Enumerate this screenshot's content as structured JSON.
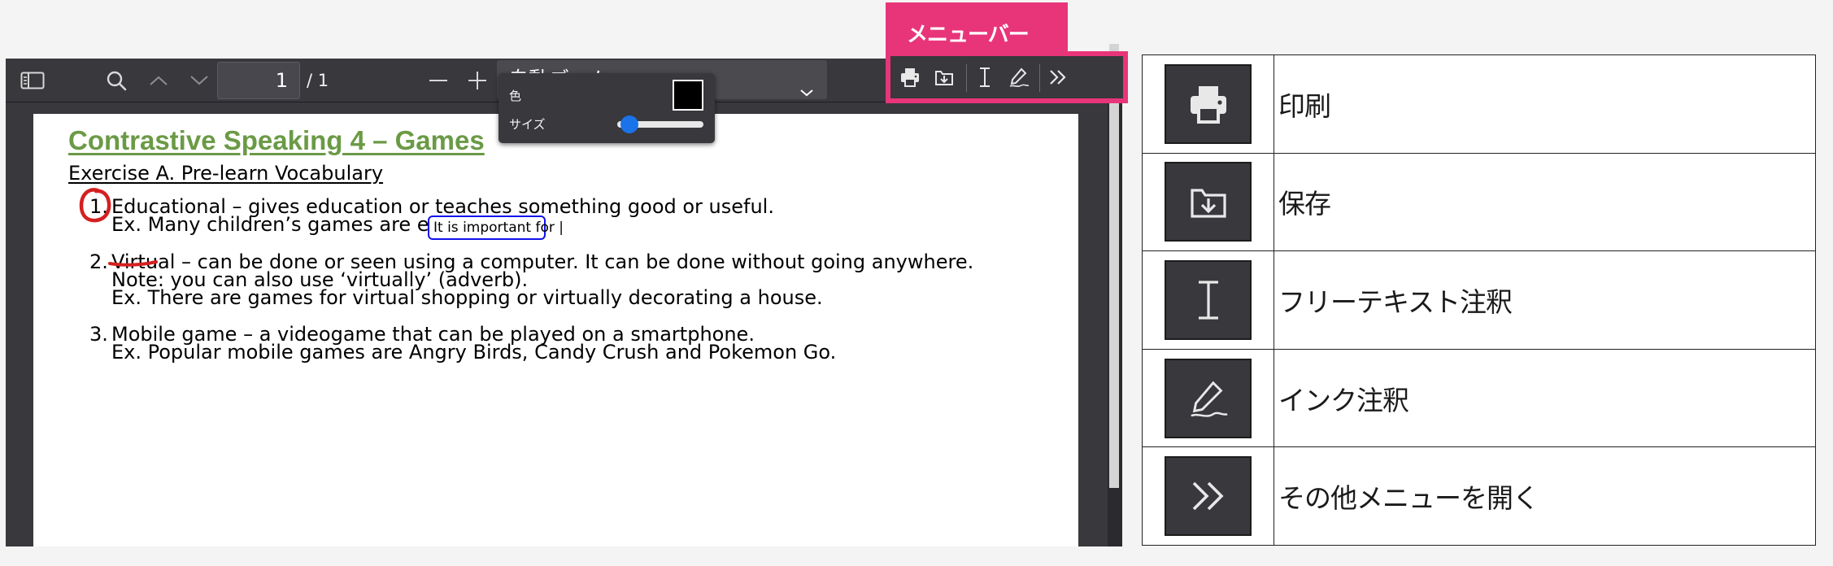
{
  "viewer": {
    "toolbar": {
      "page_number": "1",
      "page_count": "/ 1",
      "zoom": "自動ズーム"
    },
    "document": {
      "title": "Contrastive Speaking 4 – Games",
      "exercise_heading": "Exercise A. Pre-learn Vocabulary",
      "items": [
        {
          "number": "1.",
          "lines": [
            "Educational – gives education or teaches something good or useful.",
            "Ex. Many children’s games are educational."
          ]
        },
        {
          "number": "2.",
          "lines": [
            "Virtual – can be done or seen using a computer. It can be done without going anywhere.",
            "Note: you can also use ‘virtually’ (adverb).",
            "Ex. There are games for virtual shopping or virtually decorating a house."
          ]
        },
        {
          "number": "3.",
          "lines": [
            "Mobile game – a videogame that can be played on a smartphone.",
            "Ex. Popular mobile games are Angry Birds, Candy Crush and Pokemon Go."
          ]
        }
      ],
      "free_text_annotation": "It is important for |",
      "ink_color": "#d42020",
      "title_color": "#6b9a46"
    },
    "ink_popup": {
      "color_label": "色",
      "size_label": "サイズ",
      "color_value": "#000000",
      "size_fraction": 0.05
    }
  },
  "callout": {
    "label": "メニューバー",
    "color": "#e8357a",
    "icons": [
      "print-icon",
      "save-icon",
      "free-text-icon",
      "ink-icon",
      "more-menu-icon"
    ]
  },
  "legend": {
    "rows": [
      {
        "icon": "print-icon",
        "label": "印刷"
      },
      {
        "icon": "save-icon",
        "label": "保存"
      },
      {
        "icon": "free-text-icon",
        "label": "フリーテキスト注釈"
      },
      {
        "icon": "ink-icon",
        "label": "インク注釈"
      },
      {
        "icon": "more-menu-icon",
        "label": "その他メニューを開く"
      }
    ]
  }
}
